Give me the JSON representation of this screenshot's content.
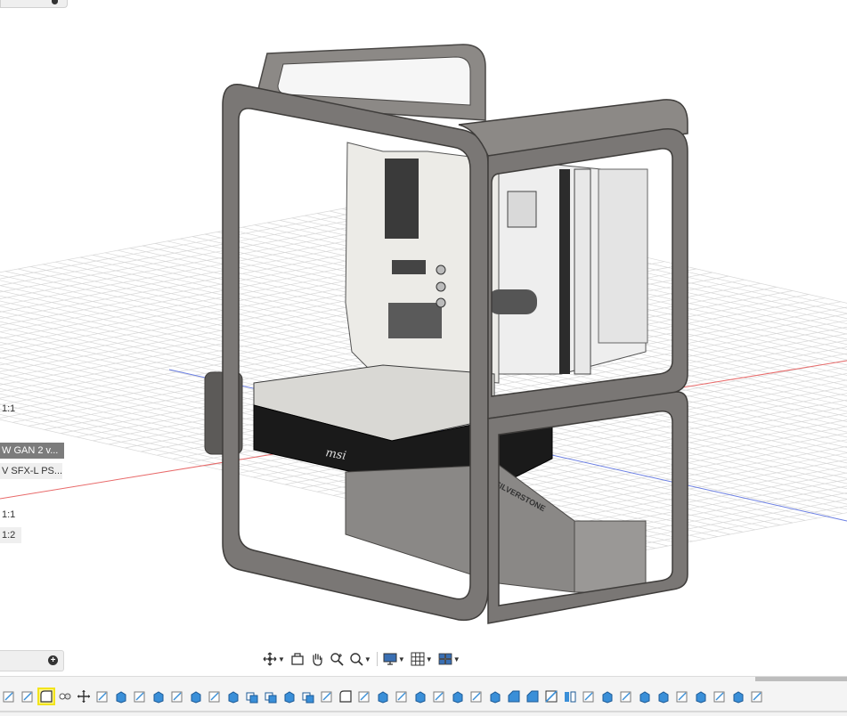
{
  "browser": {
    "items": [
      {
        "label": "1:1",
        "selected": false,
        "plain": false
      },
      {
        "label": "W GAN 2 v...",
        "selected": true,
        "plain": false
      },
      {
        "label": "V SFX-L PS...",
        "selected": false,
        "plain": true
      },
      {
        "label": "1:1",
        "selected": false,
        "plain": false
      },
      {
        "label": "1:2",
        "selected": false,
        "plain": true
      }
    ]
  },
  "model": {
    "gpu_brand": "msi",
    "psu_text": "SILVERSTONE"
  },
  "nav_toolbar": {
    "buttons": [
      "orbit-icon",
      "look-at-icon",
      "pan-hand-icon",
      "zoom-icon",
      "fit-icon",
      "display-settings-icon",
      "grid-settings-icon",
      "viewports-icon"
    ]
  },
  "timeline": {
    "features": [
      "sketch",
      "sketch",
      "fillet",
      "joint",
      "move",
      "sketch",
      "extrude",
      "sketch",
      "extrude",
      "sketch",
      "extrude",
      "sketch",
      "extrude",
      "combine",
      "combine",
      "extrude",
      "combine",
      "sketch",
      "fillet",
      "sketch",
      "extrude",
      "sketch",
      "extrude",
      "sketch",
      "extrude",
      "sketch",
      "extrude",
      "chamfer",
      "chamfer",
      "split",
      "mirror",
      "sketch",
      "extrude",
      "sketch",
      "extrude",
      "extrude",
      "sketch",
      "extrude",
      "sketch",
      "extrude",
      "sketch"
    ],
    "active_index": 2
  },
  "colors": {
    "frame": "#6f6c69",
    "frame_light": "#8c8986",
    "grid": "#d8d8d8",
    "axis_red": "#e86a6a",
    "axis_blue": "#6b7fe3",
    "feature_blue": "#3a8fd8",
    "sketch_gray": "#7a7a7a",
    "highlight": "#f2e41c"
  }
}
